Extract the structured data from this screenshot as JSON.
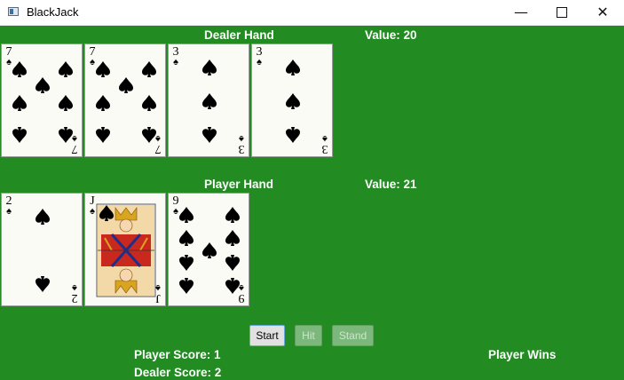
{
  "window": {
    "title": "BlackJack",
    "minimize_glyph": "—",
    "close_glyph": "✕"
  },
  "dealer": {
    "heading": "Dealer Hand",
    "value_text": "Value: 20",
    "cards": [
      {
        "rank": "7",
        "suit": "♠",
        "suit_name": "spades"
      },
      {
        "rank": "7",
        "suit": "♠",
        "suit_name": "spades"
      },
      {
        "rank": "3",
        "suit": "♠",
        "suit_name": "spades"
      },
      {
        "rank": "3",
        "suit": "♠",
        "suit_name": "spades"
      }
    ]
  },
  "player": {
    "heading": "Player Hand",
    "value_text": "Value: 21",
    "cards": [
      {
        "rank": "2",
        "suit": "♠",
        "suit_name": "spades"
      },
      {
        "rank": "J",
        "suit": "♠",
        "suit_name": "spades"
      },
      {
        "rank": "9",
        "suit": "♠",
        "suit_name": "spades"
      }
    ]
  },
  "controls": {
    "start_label": "Start",
    "hit_label": "Hit",
    "stand_label": "Stand",
    "hit_enabled": false,
    "stand_enabled": false
  },
  "scores": {
    "player_score_text": "Player Score: 1",
    "dealer_score_text": "Dealer Score: 2",
    "result_text": "Player Wins"
  },
  "colors": {
    "felt": "#228b22",
    "text": "#ffffff",
    "card_face": "#fbfbf6"
  }
}
